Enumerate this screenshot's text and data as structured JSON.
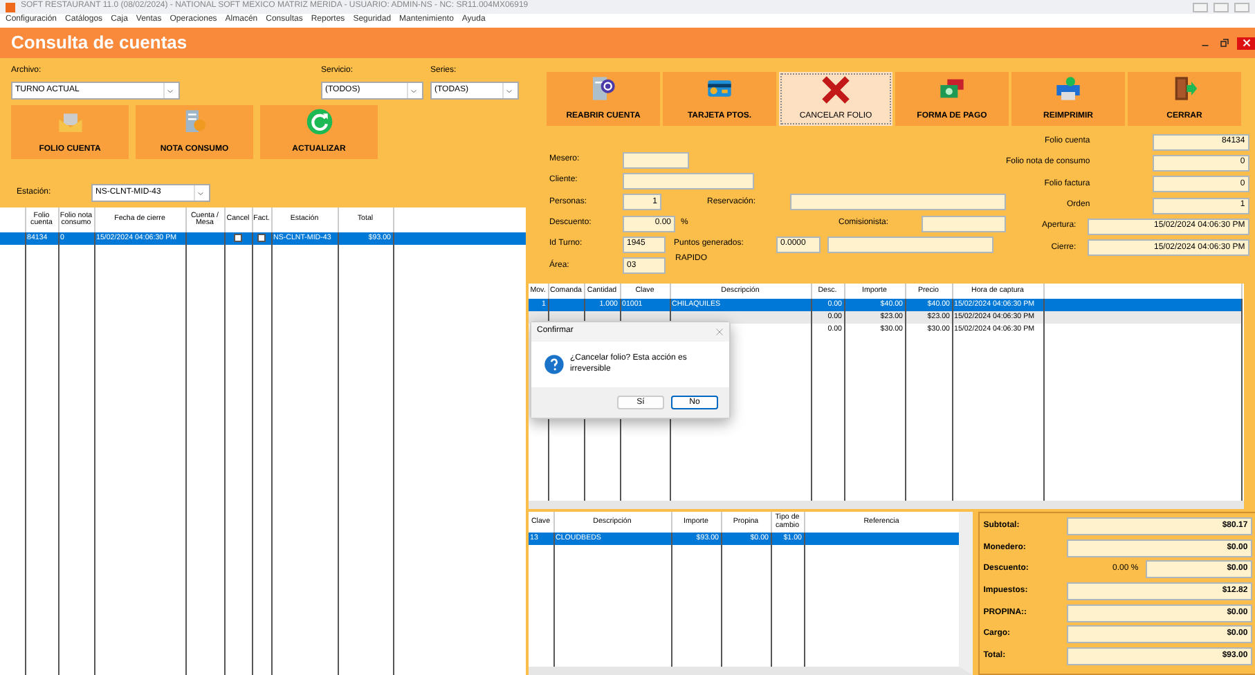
{
  "window": {
    "title": "SOFT RESTAURANT 11.0 (08/02/2024) - NATIONAL SOFT MEXICO MATRIZ MERIDA - USUARIO: ADMIN-NS - NC: SR11.004MX06919"
  },
  "menu": [
    "Configuración",
    "Catálogos",
    "Caja",
    "Ventas",
    "Operaciones",
    "Almacén",
    "Consultas",
    "Reportes",
    "Seguridad",
    "Mantenimiento",
    "Ayuda"
  ],
  "form_title": "Consulta de cuentas",
  "filters": [
    {
      "label": "Archivo:",
      "value": "TURNO ACTUAL"
    },
    {
      "label": "Servicio:",
      "value": "(TODOS)"
    },
    {
      "label": "Series:",
      "value": "(TODAS)"
    }
  ],
  "left_buttons": [
    {
      "label": "FOLIO CUENTA",
      "kind": "envelope"
    },
    {
      "label": "NOTA CONSUMO",
      "kind": "receipt"
    },
    {
      "label": "ACTUALIZAR",
      "kind": "refresh"
    }
  ],
  "station": {
    "label": "Estación:",
    "value": "NS-CLNT-MID-43"
  },
  "accounts_table": {
    "columns": [
      "Folio cuenta",
      "Folio nota consumo",
      "Fecha de cierre",
      "Cuenta / Mesa",
      "Cancel",
      "Fact.",
      "Estación",
      "Total"
    ],
    "rows": [
      {
        "selected": true,
        "folio": "84134",
        "nota": "0",
        "fecha": "15/02/2024 04:06:30 PM",
        "cancel": false,
        "fact": false,
        "estacion": "NS-CLNT-MID-43",
        "total": "$93.00"
      }
    ]
  },
  "action_buttons": [
    {
      "label": "REABRIR CUENTA",
      "kind": "document",
      "selected": false
    },
    {
      "label": "TARJETA PTOS.",
      "kind": "card",
      "selected": false
    },
    {
      "label": "CANCELAR FOLIO",
      "kind": "cross",
      "selected": true
    },
    {
      "label": "FORMA DE PAGO",
      "kind": "money",
      "selected": false
    },
    {
      "label": "REIMPRIMIR",
      "kind": "printer",
      "selected": false
    },
    {
      "label": "CERRAR",
      "kind": "door",
      "selected": false
    }
  ],
  "info_left": [
    [
      {
        "label": "Mesero:",
        "kind": "field"
      }
    ],
    [
      {
        "label": "Cliente:",
        "kind": "field"
      }
    ],
    [
      {
        "label": "Personas:",
        "kind": "field",
        "value": "1"
      },
      {
        "label": "Reservación:",
        "kind": "field"
      }
    ],
    [
      {
        "label": "Descuento:",
        "kind": "field",
        "value": "0.00",
        "unit": "%"
      },
      {
        "label": "Comisionista:",
        "kind": "field"
      }
    ],
    [
      {
        "label": "Id Turno:",
        "kind": "field",
        "value": "1945"
      },
      {
        "label": "Puntos generados:",
        "kind": "field",
        "value": "0.0000"
      },
      {
        "kind": "field"
      }
    ],
    [
      {
        "label": "Área:",
        "kind": "field",
        "value": "03"
      },
      {
        "kind": "text",
        "text": "RAPIDO"
      }
    ]
  ],
  "info_right": [
    {
      "label": "Folio cuenta",
      "value": "84134"
    },
    {
      "label": "Folio nota de consumo",
      "value": "0"
    },
    {
      "label": "Folio factura",
      "value": "0"
    },
    {
      "label": "Orden",
      "value": "1"
    },
    {
      "label": "Apertura:",
      "value": "15/02/2024 04:06:30 PM"
    },
    {
      "label": "Cierre:",
      "value": "15/02/2024 04:06:30 PM"
    }
  ],
  "items_table": {
    "columns": [
      "Mov.",
      "Comanda",
      "Cantidad",
      "Clave",
      "Descripción",
      "Desc.",
      "Importe",
      "Precio",
      "Hora de captura"
    ],
    "rows": [
      {
        "selected": true,
        "cells": [
          "1",
          "",
          "1.000",
          "01001",
          "CHILAQUILES",
          "0.00",
          "$40.00",
          "$40.00",
          "15/02/2024 04:06:30 PM"
        ]
      },
      {
        "selected": false,
        "cells": [
          "",
          "",
          "",
          "",
          "",
          "0.00",
          "$23.00",
          "$23.00",
          "15/02/2024 04:06:30 PM"
        ]
      },
      {
        "selected": false,
        "cells": [
          "",
          "",
          "",
          "",
          "",
          "0.00",
          "$30.00",
          "$30.00",
          "15/02/2024 04:06:30 PM"
        ]
      }
    ]
  },
  "dialog": {
    "title": "Confirmar",
    "message": "¿Cancelar folio? Esta acción es irreversible",
    "buttons": [
      {
        "label": "Sí",
        "selected": false
      },
      {
        "label": "No",
        "selected": true
      }
    ]
  },
  "payments_table": {
    "columns": [
      "Clave",
      "Descripción",
      "Importe",
      "Propina",
      "Tipo de cambio",
      "Referencia"
    ],
    "rows": [
      {
        "selected": true,
        "cells": [
          "13",
          "CLOUDBEDS",
          "$93.00",
          "$0.00",
          "$1.00",
          ""
        ]
      }
    ]
  },
  "totals": [
    {
      "label": "Subtotal:",
      "value": "$80.17"
    },
    {
      "label": "Monedero:",
      "value": "$0.00"
    },
    {
      "label": "Descuento:",
      "percent": "0.00 %",
      "value": "$0.00"
    },
    {
      "label": "Impuestos:",
      "value": "$12.82"
    },
    {
      "label": "PROPINA::",
      "value": "$0.00"
    },
    {
      "label": "Cargo:",
      "value": "$0.00"
    },
    {
      "label": "Total:",
      "value": "$93.00"
    }
  ]
}
